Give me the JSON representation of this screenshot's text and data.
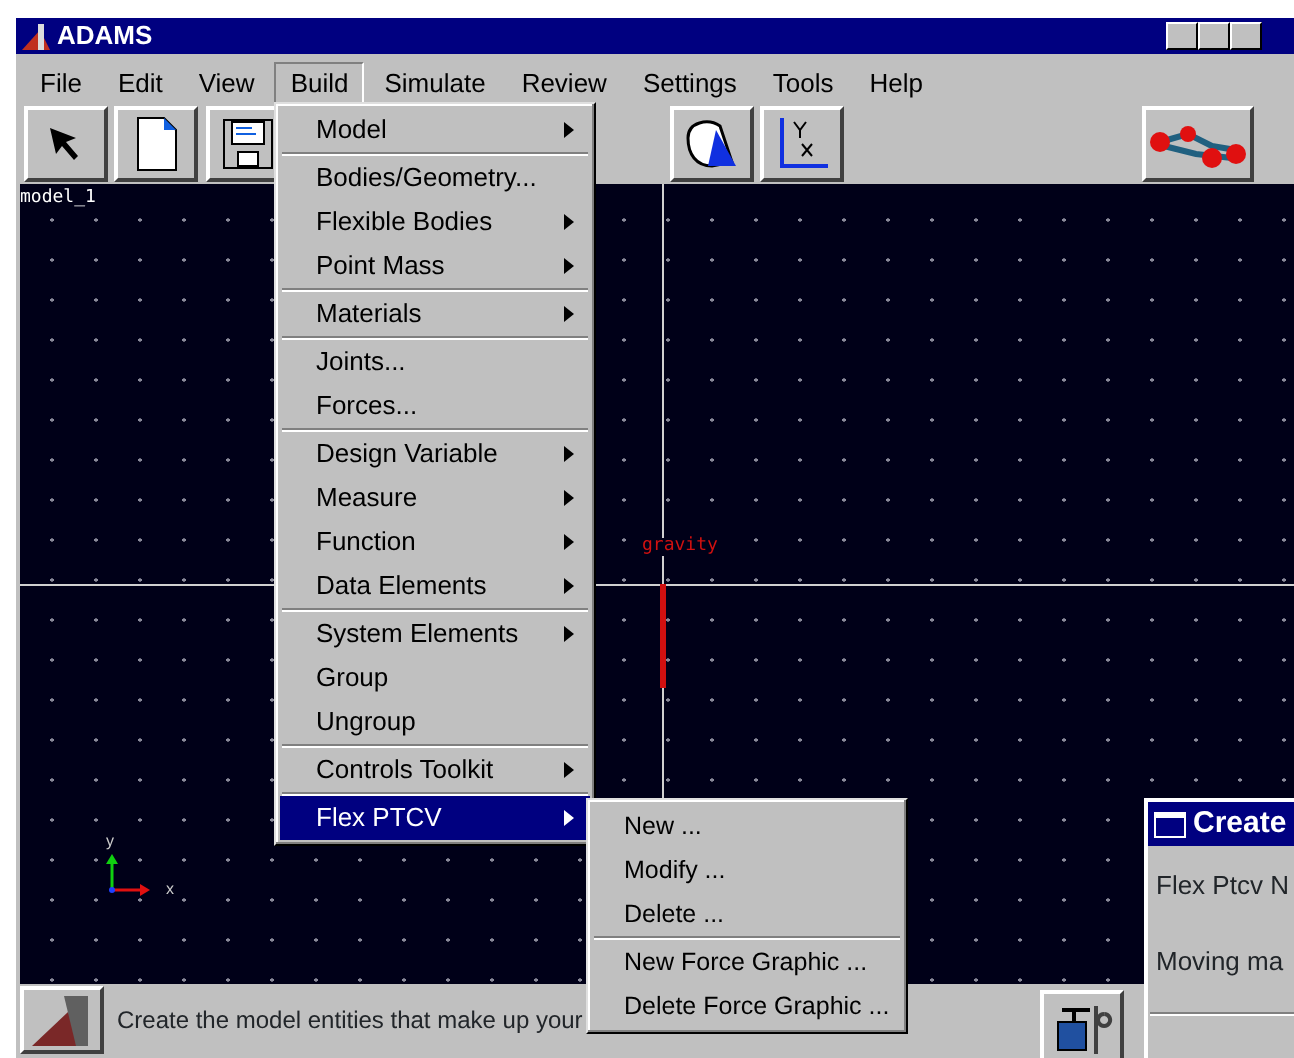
{
  "window": {
    "title": "ADAMS"
  },
  "menu_bar": [
    {
      "label": "File",
      "selected": false
    },
    {
      "label": "Edit",
      "selected": false
    },
    {
      "label": "View",
      "selected": false
    },
    {
      "label": "Build",
      "selected": true
    },
    {
      "label": "Simulate",
      "selected": false
    },
    {
      "label": "Review",
      "selected": false
    },
    {
      "label": "Settings",
      "selected": false
    },
    {
      "label": "Tools",
      "selected": false
    },
    {
      "label": "Help",
      "selected": false
    }
  ],
  "canvas": {
    "model_name": "model_1",
    "gravity_label": "gravity",
    "triad": {
      "x_label": "x",
      "y_label": "y"
    }
  },
  "build_menu": [
    [
      {
        "label": "Model",
        "submenu": true,
        "selected": false
      }
    ],
    [
      {
        "label": "Bodies/Geometry...",
        "submenu": false,
        "selected": false
      },
      {
        "label": "Flexible Bodies",
        "submenu": true,
        "selected": false
      },
      {
        "label": "Point Mass",
        "submenu": true,
        "selected": false
      }
    ],
    [
      {
        "label": "Materials",
        "submenu": true,
        "selected": false
      }
    ],
    [
      {
        "label": "Joints...",
        "submenu": false,
        "selected": false
      },
      {
        "label": "Forces...",
        "submenu": false,
        "selected": false
      }
    ],
    [
      {
        "label": "Design Variable",
        "submenu": true,
        "selected": false
      },
      {
        "label": "Measure",
        "submenu": true,
        "selected": false
      },
      {
        "label": "Function",
        "submenu": true,
        "selected": false
      },
      {
        "label": "Data Elements",
        "submenu": true,
        "selected": false
      }
    ],
    [
      {
        "label": "System Elements",
        "submenu": true,
        "selected": false
      },
      {
        "label": "Group",
        "submenu": false,
        "selected": false
      },
      {
        "label": "Ungroup",
        "submenu": false,
        "selected": false
      }
    ],
    [
      {
        "label": "Controls Toolkit",
        "submenu": true,
        "selected": false
      }
    ],
    [
      {
        "label": "Flex PTCV",
        "submenu": true,
        "selected": true
      }
    ]
  ],
  "flex_submenu": [
    [
      {
        "label": "New ..."
      },
      {
        "label": "Modify ..."
      },
      {
        "label": "Delete ..."
      }
    ],
    [
      {
        "label": "New Force Graphic ..."
      },
      {
        "label": "Delete Force Graphic ..."
      }
    ]
  ],
  "status_bar": {
    "message": "Create the model entities that make up your"
  },
  "dialog": {
    "title": "Create",
    "fields": [
      "Flex Ptcv N",
      "Moving ma"
    ]
  }
}
